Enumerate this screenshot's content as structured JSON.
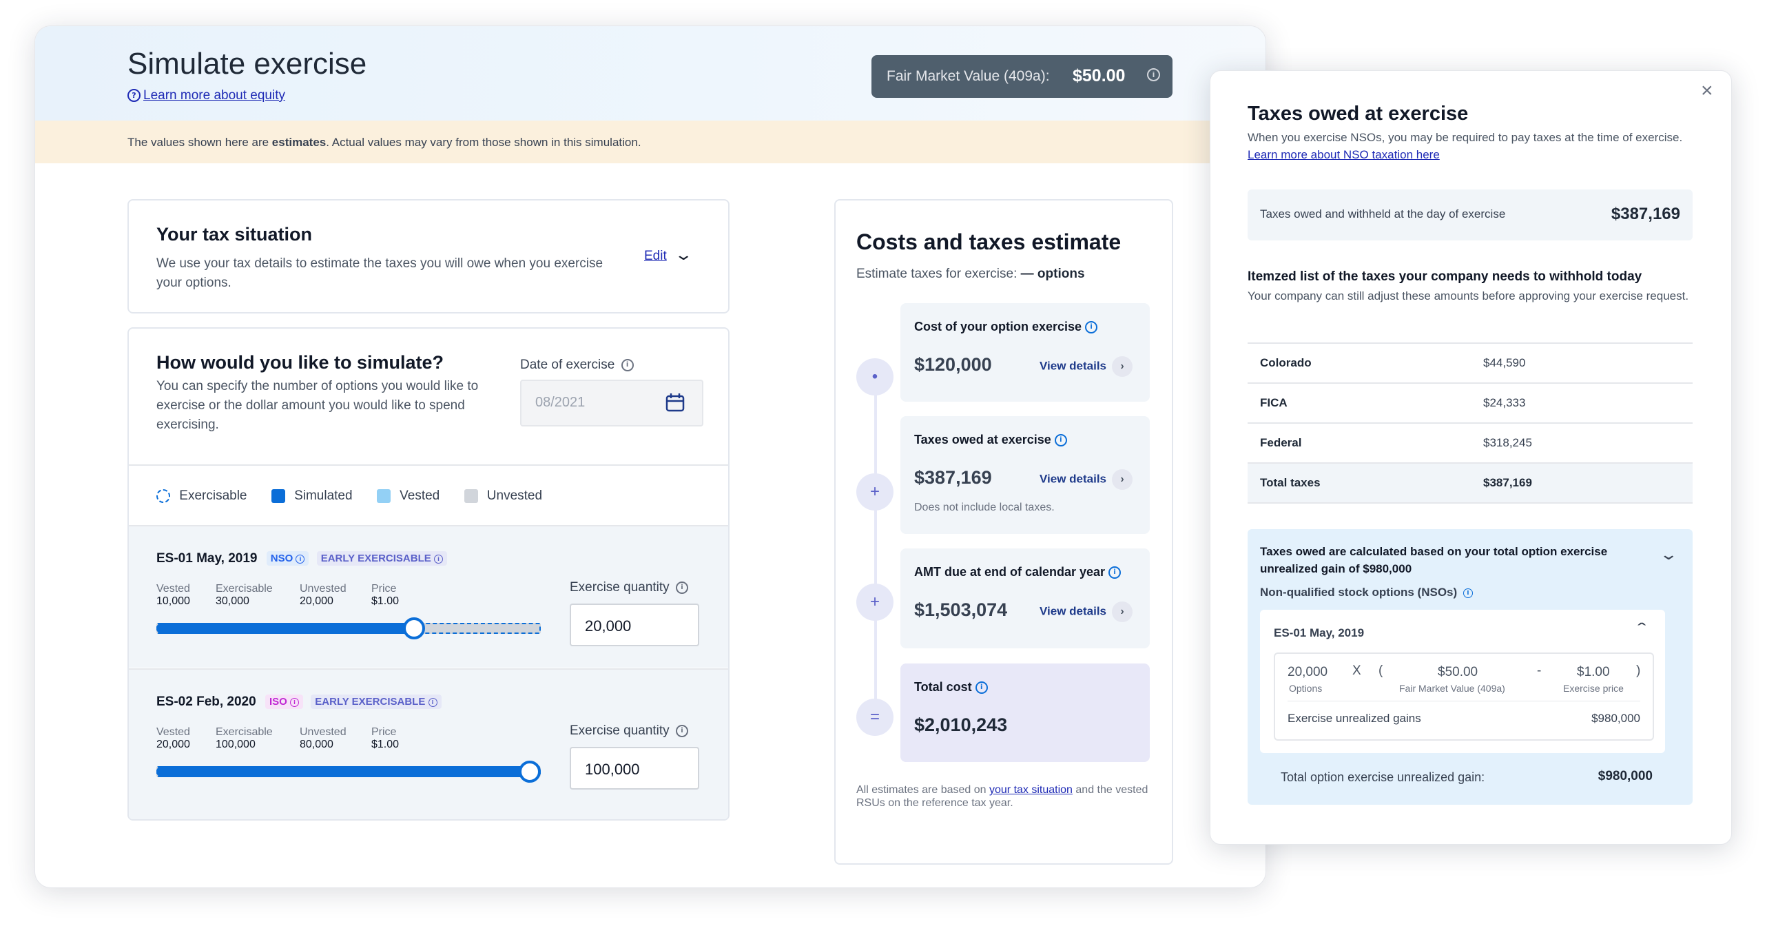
{
  "header": {
    "title": "Simulate exercise",
    "learn_more": "Learn more about equity",
    "fmv_label": "Fair Market Value (409a):",
    "fmv_value": "$50.00"
  },
  "notice": {
    "prefix": "The values shown here are ",
    "bold": "estimates",
    "suffix": ". Actual values may vary from those shown in this simulation."
  },
  "tax_situation": {
    "title": "Your tax situation",
    "description": "We use your tax details to estimate the taxes you will owe when you exercise your options.",
    "edit_label": "Edit"
  },
  "simulate": {
    "title": "How would you like to simulate?",
    "description": "You can specify the number of options you would like to exercise or the dollar amount you would like to spend exercising.",
    "date_label": "Date of exercise",
    "date_value": "08/2021",
    "legend": [
      "Exercisable",
      "Simulated",
      "Vested",
      "Unvested"
    ],
    "grants": [
      {
        "name": "ES-01 May, 2019",
        "type": "NSO",
        "badge": "EARLY EXERCISABLE",
        "cols": [
          {
            "label": "Vested",
            "value": "10,000"
          },
          {
            "label": "Exercisable",
            "value": "30,000"
          },
          {
            "label": "Unvested",
            "value": "20,000"
          },
          {
            "label": "Price",
            "value": "$1.00"
          }
        ],
        "qty_label": "Exercise quantity",
        "qty_value": "20,000",
        "slider_level": 0.67
      },
      {
        "name": "ES-02 Feb, 2020",
        "type": "ISO",
        "badge": "EARLY EXERCISABLE",
        "cols": [
          {
            "label": "Vested",
            "value": "20,000"
          },
          {
            "label": "Exercisable",
            "value": "100,000"
          },
          {
            "label": "Unvested",
            "value": "80,000"
          },
          {
            "label": "Price",
            "value": "$1.00"
          }
        ],
        "qty_label": "Exercise quantity",
        "qty_value": "100,000",
        "slider_level": 1.0
      }
    ]
  },
  "estimate": {
    "title": "Costs and taxes estimate",
    "subtitle_prefix": "Estimate taxes for exercise: ",
    "subtitle_bold": "— options",
    "steps": [
      {
        "symbol": "•",
        "label": "Cost of your option exercise",
        "value": "$120,000",
        "link": "View details",
        "note": ""
      },
      {
        "symbol": "+",
        "label": "Taxes owed at exercise",
        "value": "$387,169",
        "link": "View details",
        "note": "Does not include local taxes."
      },
      {
        "symbol": "+",
        "label": "AMT due at end of calendar year",
        "value": "$1,503,074",
        "link": "View details",
        "note": ""
      },
      {
        "symbol": "=",
        "label": "Total cost",
        "value": "$2,010,243",
        "link": "",
        "note": ""
      }
    ],
    "footer_prefix": "All estimates are based on ",
    "footer_link": "your tax situation",
    "footer_suffix": " and the vested RSUs on the reference tax year."
  },
  "panel": {
    "title": "Taxes owed at exercise",
    "desc_prefix": "When you exercise NSOs, you may be required to pay taxes at the time of exercise. ",
    "desc_link": "Learn more about NSO taxation here",
    "summary_label": "Taxes owed and withheld at the day of exercise",
    "summary_value": "$387,169",
    "itemized_title": "Itemzed list of the taxes your company needs to withhold today",
    "itemized_desc": "Your company can still adjust these amounts before approving your exercise request.",
    "rows": [
      {
        "name": "Colorado",
        "value": "$44,590"
      },
      {
        "name": "FICA",
        "value": "$24,333"
      },
      {
        "name": "Federal",
        "value": "$318,245"
      },
      {
        "name": "Total taxes",
        "value": "$387,169"
      }
    ],
    "calc_title": "Taxes owed are calculated based on your total option exercise unrealized gain of $980,000",
    "calc_sub": "Non-qualified stock options (NSOs)",
    "grant_name": "ES-01 May, 2019",
    "formula": {
      "options": "20,000",
      "options_label": "Options",
      "times": "X",
      "open": "(",
      "close": ")",
      "minus": "-",
      "fmv": "$50.00",
      "fmv_label": "Fair Market Value (409a)",
      "price": "$1.00",
      "price_label": "Exercise price"
    },
    "gain_label": "Exercise unrealized gains",
    "gain_value": "$980,000",
    "total_label": "Total option exercise unrealized gain:",
    "total_value": "$980,000"
  },
  "colors": {
    "accent": "#0b6ed8",
    "link": "#1e2ab5",
    "nso": "#2563eb",
    "iso": "#c026d3",
    "badge": "#5b61c9"
  }
}
